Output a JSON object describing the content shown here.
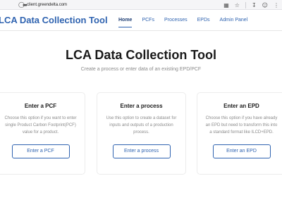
{
  "browser": {
    "url_host": "client.greendelta.com",
    "icons": [
      "shield-icon",
      "lock-icon",
      "grid-icon",
      "star-icon",
      "download-icon",
      "profile-icon",
      "menu-icon"
    ]
  },
  "header": {
    "brand": "LCA Data Collection Tool",
    "nav": [
      {
        "label": "Home",
        "active": true
      },
      {
        "label": "PCFs"
      },
      {
        "label": "Processes"
      },
      {
        "label": "EPDs"
      },
      {
        "label": "Admin Panel"
      }
    ]
  },
  "hero": {
    "title": "LCA Data Collection Tool",
    "subtitle": "Create a process or enter data of an existing EPD/PCF"
  },
  "cards": [
    {
      "title": "Enter a PCF",
      "desc": [
        "Choose this option if you want to enter",
        "single Product Carbon Footprint(PCF)",
        "value for a product."
      ],
      "button": "Enter a PCF"
    },
    {
      "title": "Enter a process",
      "desc": [
        "Use this option to create a dataset for",
        "inputs and outputs of a production",
        "process."
      ],
      "button": "Enter a process"
    },
    {
      "title": "Enter an EPD",
      "desc": [
        "Choose this option if you have already",
        "an EPD but need to transform this into",
        "a standard format like ILCD+EPD."
      ],
      "button": "Enter an EPD"
    }
  ],
  "colors": {
    "brand": "#2f63b0",
    "text": "#1a1a1a",
    "muted": "#8a8a8a",
    "border": "#ececec"
  }
}
